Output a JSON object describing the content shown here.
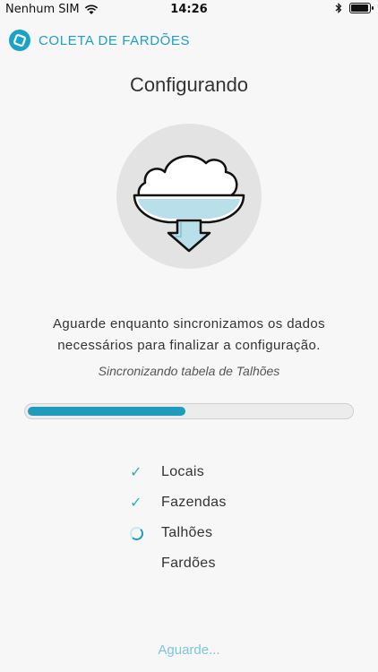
{
  "status_bar": {
    "carrier": "Nenhum SIM",
    "time": "14:26"
  },
  "header": {
    "title": "COLETA DE FARDÕES",
    "accent_color": "#1d9fbf"
  },
  "main": {
    "title": "Configurando",
    "description_line1": "Aguarde enquanto sincronizamos os dados",
    "description_line2": "necessários para finalizar a configuração.",
    "sync_status": "Sincronizando tabela de Talhões",
    "progress": 0.49,
    "tasks": [
      {
        "label": "Locais",
        "state": "done"
      },
      {
        "label": "Fazendas",
        "state": "done"
      },
      {
        "label": "Talhões",
        "state": "in-progress"
      },
      {
        "label": "Fardões",
        "state": "pending"
      }
    ],
    "wait_label": "Aguarde..."
  }
}
